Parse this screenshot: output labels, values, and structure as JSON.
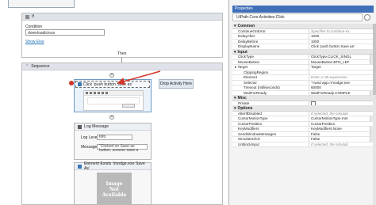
{
  "designer": {
    "if_block": {
      "title": "If",
      "condition_label": "Condition",
      "condition_value": "downloadicious",
      "show_else": "Show Else",
      "then_label": "Then"
    },
    "sequence": {
      "title": "Sequence"
    },
    "click_activity": {
      "title": "Click 'push button Save as'"
    },
    "drop_tooltip": "Drop Activity Here",
    "log_message": {
      "title": "Log Message",
      "level_label": "Log Level",
      "level_value": "Info",
      "message_label": "Message",
      "message_value": "\"Clicked on Save as button, sooooo save a"
    },
    "element_exists": {
      "title": "Element Exists 'imodge.exe Save As'",
      "placeholder_image": [
        "Image",
        "Not",
        "Available"
      ]
    }
  },
  "properties": {
    "panel_title": "Properties",
    "type_name": "UiPath.Core.Activities.Click",
    "categories": [
      {
        "name": "Common",
        "rows": [
          {
            "name": "ContinueOnError",
            "value": "Specifies to continue ex",
            "placeholder": true
          },
          {
            "name": "DelayAfter",
            "value": "1000"
          },
          {
            "name": "DelayBefore",
            "value": "1000"
          },
          {
            "name": "DisplayName",
            "value": "Click 'push button Save as'"
          }
        ]
      },
      {
        "name": "Input",
        "rows": [
          {
            "name": "ClickType",
            "value": "ClickType.CLICK_SINGL",
            "dropdown": true
          },
          {
            "name": "MouseButton",
            "value": "MouseButton.BTN_LEF",
            "dropdown": true
          },
          {
            "name": "Target",
            "value": "Target",
            "group": true
          },
          {
            "name": "ClippingRegion",
            "value": "",
            "sub": true
          },
          {
            "name": "Element",
            "value": "Enter a VB expression",
            "placeholder": true,
            "sub": true
          },
          {
            "name": "Selector",
            "value": "\"<wnd app='imodge.exe",
            "sub": true
          },
          {
            "name": "Timeout (milliseconds)",
            "value": "60000",
            "sub": true
          },
          {
            "name": "WaitForReady",
            "value": "WaitForReady.COMPLE",
            "dropdown": true,
            "sub": true
          }
        ]
      },
      {
        "name": "Misc",
        "rows": [
          {
            "name": "Private",
            "value": "",
            "check": true
          }
        ]
      },
      {
        "name": "Options",
        "rows": [
          {
            "name": "AlterIfDisabled",
            "value": "If selected, the simulati",
            "placeholder": true
          },
          {
            "name": "CursorMotionType",
            "value": "CursorMotionType.Inst",
            "dropdown": true
          },
          {
            "name": "CursorPosition",
            "value": "CursorPosition"
          },
          {
            "name": "KeyModifiers",
            "value": "KeyModifiers.None",
            "dropdown": true
          },
          {
            "name": "SendWindowMessages",
            "value": "False",
            "dropdown": true
          },
          {
            "name": "SimulateClick",
            "value": "False",
            "dropdown": true
          },
          {
            "name": "UnblockInput",
            "value": "If selected, the simulati",
            "placeholder": true
          }
        ]
      }
    ]
  },
  "colors": {
    "accent": "#3e6fb8",
    "annotation_arrow": "#d2352b",
    "selected_activity": "#eaf2fb"
  }
}
